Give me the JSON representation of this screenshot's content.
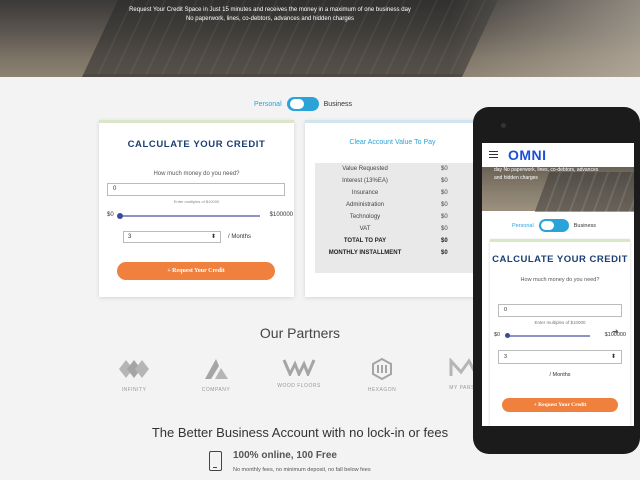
{
  "hero": {
    "line1": "Request Your Credit Space in Just 15 minutes and receives the money in a maximum of one business day",
    "line2": "No paperwork, lines, co-debtors, advances and hidden charges"
  },
  "toggle": {
    "personal": "Personal",
    "business": "Business"
  },
  "calculator": {
    "title": "CALCULATE YOUR CREDIT",
    "question": "How much money do you need?",
    "amount_value": "0",
    "hint": "Enter multiples of $10000",
    "slider_min": "$0",
    "slider_max": "$100000",
    "term_value": "3",
    "term_unit": "/ Months",
    "request_button": "+ Request Your Credit"
  },
  "summary": {
    "title": "Clear Account Value To Pay",
    "rows": [
      {
        "label": "Value Requested",
        "value": "$0"
      },
      {
        "label": "Interest (13%EA)",
        "value": "$0"
      },
      {
        "label": "Insurance",
        "value": "$0"
      },
      {
        "label": "Administration",
        "value": "$0"
      },
      {
        "label": "Technology",
        "value": "$0"
      },
      {
        "label": "VAT",
        "value": "$0"
      },
      {
        "label": "TOTAL TO PAY",
        "value": "$0"
      },
      {
        "label": "MONTHLY INSTALLMENT",
        "value": "$0"
      }
    ]
  },
  "partners": {
    "title": "Our Partners",
    "logos": [
      {
        "caption": "INFINITY"
      },
      {
        "caption": "COMPANY"
      },
      {
        "caption": "WOOD FLOORS"
      },
      {
        "caption": "HEXAGON"
      },
      {
        "caption": "MY PARSE"
      }
    ]
  },
  "business_account": {
    "title": "The Better Business Account with no lock-in or fees",
    "feature_title": "100% online, 100 Free",
    "feature_sub": "No monthly fees, no minimum deposit, no fall below fees"
  },
  "mobile": {
    "logo": "OMNI",
    "hero_line1": "day No paperwork, lines, co-debtors, advances",
    "hero_line2": "and hidden charges",
    "toggle_personal": "Personal",
    "toggle_business": "Business",
    "title": "CALCULATE YOUR CREDIT",
    "question": "How much money do you need?",
    "amount_value": "0",
    "hint": "Enter multiples of $10000",
    "slider_min": "$0",
    "slider_max": "$100000",
    "term_value": "3",
    "term_unit": "/ Months",
    "request_button": "+ Request Your Credit"
  },
  "icons": {
    "scroll_arrow": "arrow-right-icon",
    "phone": "smartphone-icon",
    "menu": "hamburger-menu-icon"
  },
  "colors": {
    "accent_blue": "#2aa3d9",
    "title_navy": "#1c3f73",
    "button_orange": "#f0803e",
    "logo_blue": "#1d4fd6"
  }
}
